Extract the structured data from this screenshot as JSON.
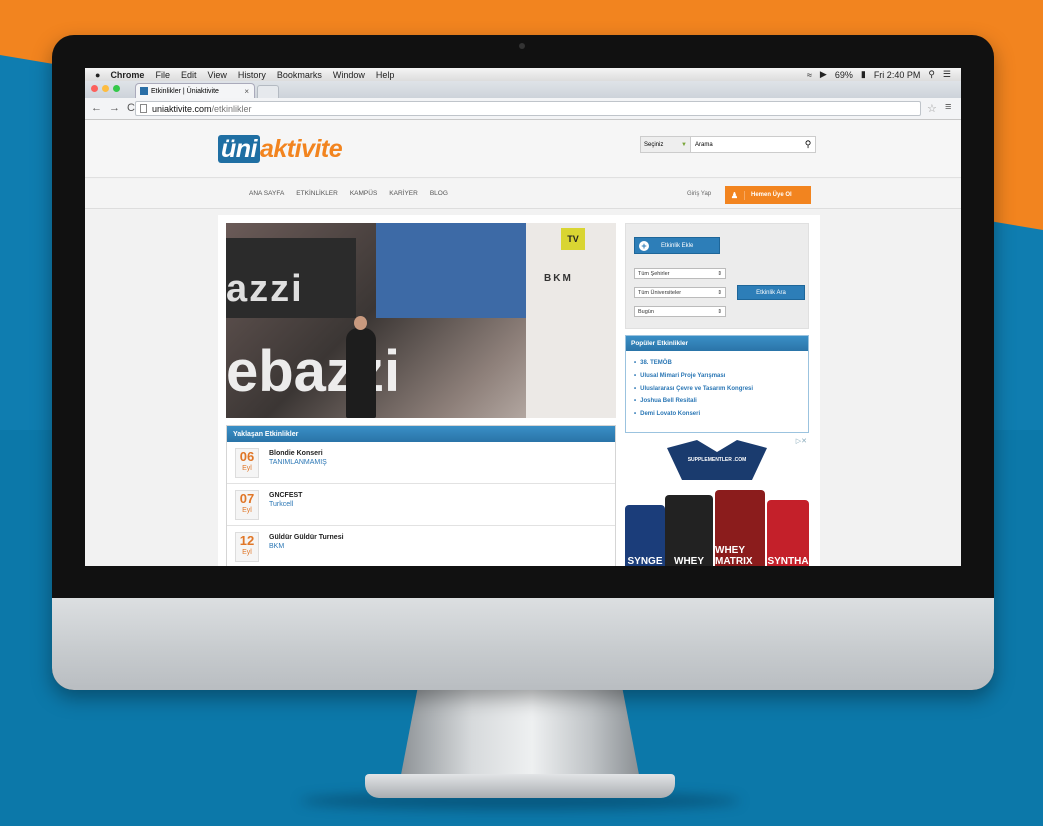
{
  "menubar": {
    "apple": "",
    "app": "Chrome",
    "items": [
      "File",
      "Edit",
      "View",
      "History",
      "Bookmarks",
      "Window",
      "Help"
    ],
    "battery": "69%",
    "clock": "Fri 2:40 PM"
  },
  "browser": {
    "tab_title": "Etkinlikler | Üniaktivite",
    "url_domain": "uniaktivite.com",
    "url_path": "/etkinlikler"
  },
  "site": {
    "logo_uni": "üni",
    "logo_aktivite": "aktivite",
    "search_select": "Seçiniz",
    "search_placeholder": "Arama",
    "nav": [
      "ANA SAYFA",
      "ETKİNLİKLER",
      "KAMPÜS",
      "KARİYER",
      "BLOG"
    ],
    "login": "Giriş Yap",
    "signup": "Hemen Üye Ol"
  },
  "hero": {
    "tv": "TV",
    "bkm": "BKM",
    "text_top": "azzi",
    "text_bottom": "ebazzi"
  },
  "upcoming": {
    "title": "Yaklaşan Etkinlikler",
    "events": [
      {
        "day": "06",
        "month": "Eyl",
        "name": "Blondie Konseri",
        "place": "TANIMLANMAMIŞ"
      },
      {
        "day": "07",
        "month": "Eyl",
        "name": "GNCFEST",
        "place": "Turkcell"
      },
      {
        "day": "12",
        "month": "Eyl",
        "name": "Güldür Güldür Turnesi",
        "place": "BKM"
      }
    ]
  },
  "sidebar": {
    "add_event": "Etkinlik Ekle",
    "city": "Tüm Şehirler",
    "university": "Tüm Üniversiteler",
    "date": "Bugün",
    "search_button": "Etkinlik Ara"
  },
  "popular": {
    "title": "Popüler Etkinlikler",
    "items": [
      "38. TEMÖB",
      "Ulusal Mimari Proje Yarışması",
      "Uluslararası Çevre ve Tasarım Kongresi",
      "Joshua Bell Resitali",
      "Demi Lovato Konseri"
    ]
  },
  "ad": {
    "brand": "SUPPLEMENTLER .COM",
    "products": [
      "SYNGE",
      "WHEY",
      "WHEY MATRIX",
      "SYNTHA"
    ]
  },
  "colors": {
    "orange": "#f2841f",
    "blue": "#2d7eb8",
    "bg_blue": "#0f7db0"
  }
}
